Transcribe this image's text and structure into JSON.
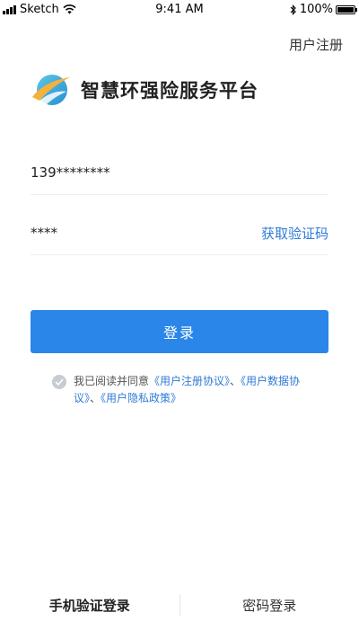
{
  "status_bar": {
    "carrier": "Sketch",
    "time": "9:41 AM",
    "battery": "100%"
  },
  "header": {
    "register_label": "用户注册"
  },
  "brand": {
    "title": "智慧环强险服务平台",
    "logo_icon": "globe-swoosh-logo"
  },
  "form": {
    "phone_value": "139********",
    "code_value": "****",
    "get_code_label": "获取验证码"
  },
  "login_button": {
    "label": "登录"
  },
  "agreement": {
    "prefix": "我已阅读并同意",
    "link1": "《用户注册协议》",
    "sep1": "、",
    "link2": "《用户数据协议》",
    "sep2": "、",
    "link3": "《用户隐私政策》"
  },
  "tabs": [
    {
      "label": "手机验证登录",
      "active": true
    },
    {
      "label": "密码登录",
      "active": false
    }
  ],
  "colors": {
    "accent": "#2b86e9",
    "link": "#2f7bd6"
  }
}
